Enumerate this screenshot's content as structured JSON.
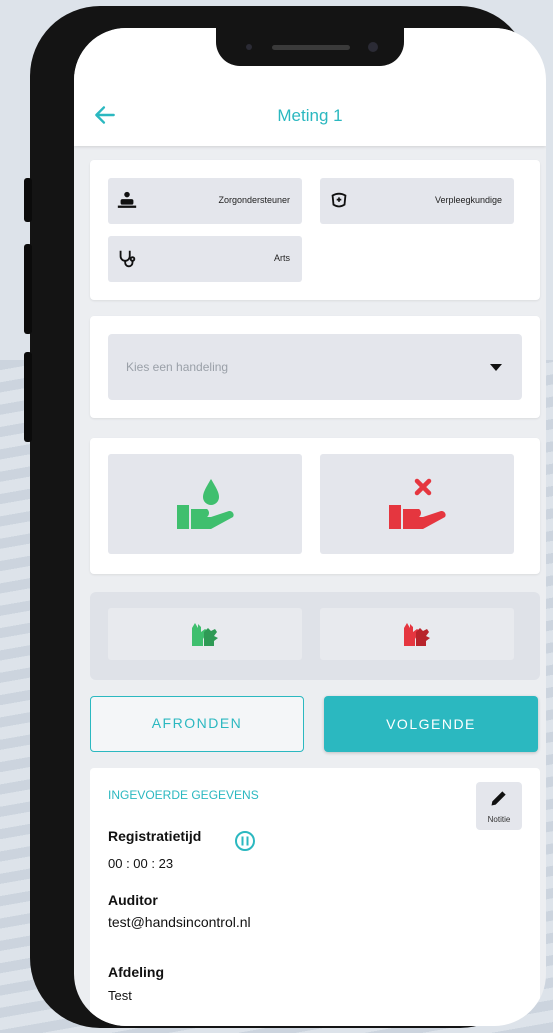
{
  "header": {
    "title": "Meting 1",
    "back_icon": "arrow-left-icon"
  },
  "roles": [
    {
      "label": "Zorgondersteuner",
      "icon": "caregiver-icon"
    },
    {
      "label": "Verpleegkundige",
      "icon": "nurse-cap-icon"
    },
    {
      "label": "Arts",
      "icon": "stethoscope-icon"
    }
  ],
  "action_select": {
    "placeholder": "Kies een handeling"
  },
  "hygiene_buttons": [
    {
      "icon": "hand-wash-yes-icon",
      "color": "#3fbf6e"
    },
    {
      "icon": "hand-wash-no-icon",
      "color": "#e5363f"
    }
  ],
  "glove_buttons": [
    {
      "icon": "gloves-yes-icon",
      "color": "#3fbf6e"
    },
    {
      "icon": "gloves-no-icon",
      "color": "#e5363f"
    }
  ],
  "actions": {
    "finish_label": "AFRONDEN",
    "next_label": "VOLGENDE"
  },
  "entered_data": {
    "heading": "INGEVOERDE GEGEVENS",
    "note_label": "Notitie",
    "registration_label": "Registratietijd",
    "registration_time": "00 : 00 : 23",
    "auditor_label": "Auditor",
    "auditor_value": "test@handsincontrol.nl",
    "department_label": "Afdeling",
    "department_value": "Test"
  },
  "colors": {
    "accent": "#2bb8c0",
    "positive": "#3fbf6e",
    "negative": "#e5363f"
  }
}
